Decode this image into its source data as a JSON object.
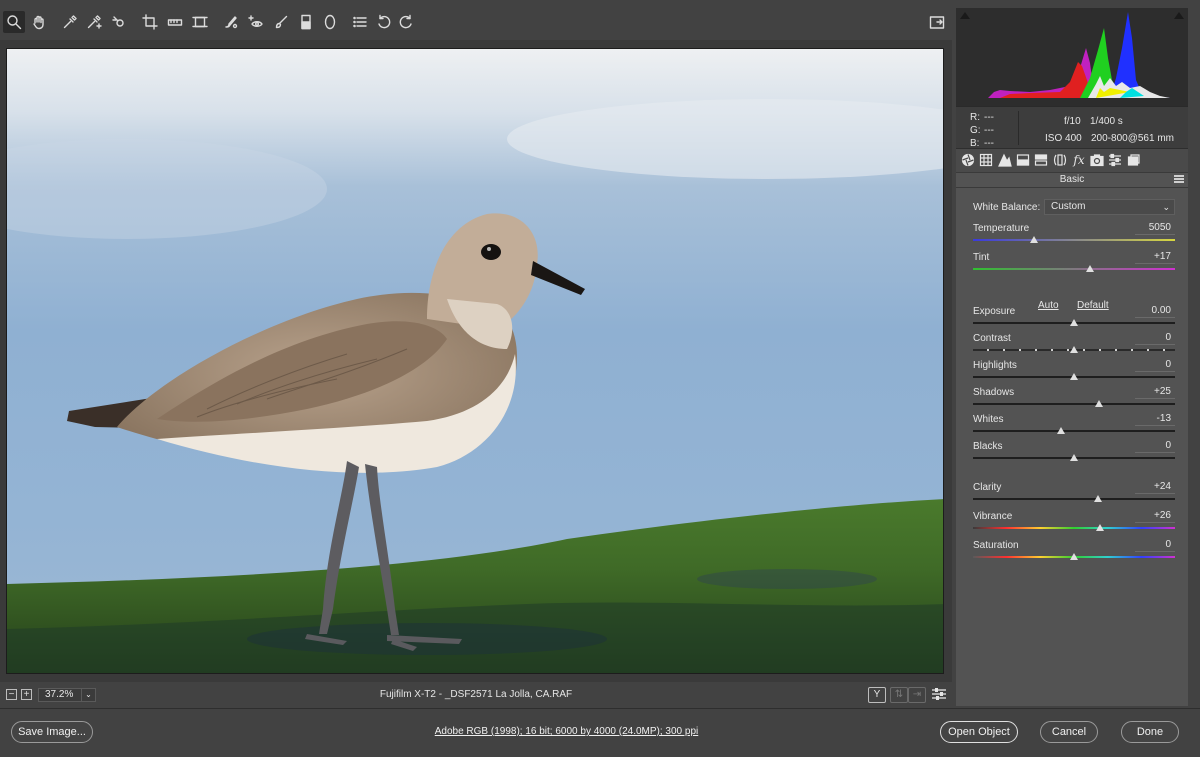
{
  "toolbar": {
    "tools": [
      "zoom-tool",
      "hand-tool",
      "white-balance-tool",
      "color-sampler-tool",
      "targeted-adjustment-tool",
      "crop-tool",
      "straighten-tool",
      "transform-tool",
      "spot-removal-tool",
      "red-eye-tool",
      "adjustment-brush",
      "graduated-filter",
      "radial-filter",
      "preferences",
      "rotate-ccw",
      "rotate-cw"
    ]
  },
  "histogram": {
    "clip_shadow": "shadow-clipping-warning",
    "clip_highlight": "highlight-clipping-warning"
  },
  "rgb_readout": {
    "r_label": "R:",
    "r_value": "---",
    "g_label": "G:",
    "g_value": "---",
    "b_label": "B:",
    "b_value": "---"
  },
  "exif": {
    "aperture": "f/10",
    "shutter": "1/400 s",
    "iso": "ISO 400",
    "lens": "200-800@561 mm"
  },
  "panel": {
    "section_title": "Basic",
    "white_balance_label": "White Balance:",
    "white_balance_value": "Custom",
    "auto_label": "Auto",
    "default_label": "Default"
  },
  "sliders": [
    {
      "label": "Temperature",
      "value": "5050",
      "level": 0.3
    },
    {
      "label": "Tint",
      "value": "+17",
      "level": 0.58
    },
    {
      "label": "Exposure",
      "value": "0.00",
      "level": 0.5
    },
    {
      "label": "Contrast",
      "value": "0",
      "level": 0.5
    },
    {
      "label": "Highlights",
      "value": "0",
      "level": 0.5
    },
    {
      "label": "Shadows",
      "value": "+25",
      "level": 0.625
    },
    {
      "label": "Whites",
      "value": "-13",
      "level": 0.435
    },
    {
      "label": "Blacks",
      "value": "0",
      "level": 0.5
    },
    {
      "label": "Clarity",
      "value": "+24",
      "level": 0.62
    },
    {
      "label": "Vibrance",
      "value": "+26",
      "level": 0.63
    },
    {
      "label": "Saturation",
      "value": "0",
      "level": 0.5
    }
  ],
  "preview_status": {
    "zoom": "37.2%",
    "file_title": "Fujifilm X-T2  -  _DSF2571 La Jolla, CA.RAF",
    "y_toggle": "Y"
  },
  "footer": {
    "save_label": "Save Image...",
    "workflow_options": "Adobe RGB (1998); 16 bit; 6000 by 4000 (24.0MP); 300 ppi",
    "open_label": "Open Object",
    "cancel_label": "Cancel",
    "done_label": "Done"
  },
  "colors": {
    "background": "#424242",
    "panel": "#535353",
    "histogram_bg": "#2d2d2d"
  }
}
